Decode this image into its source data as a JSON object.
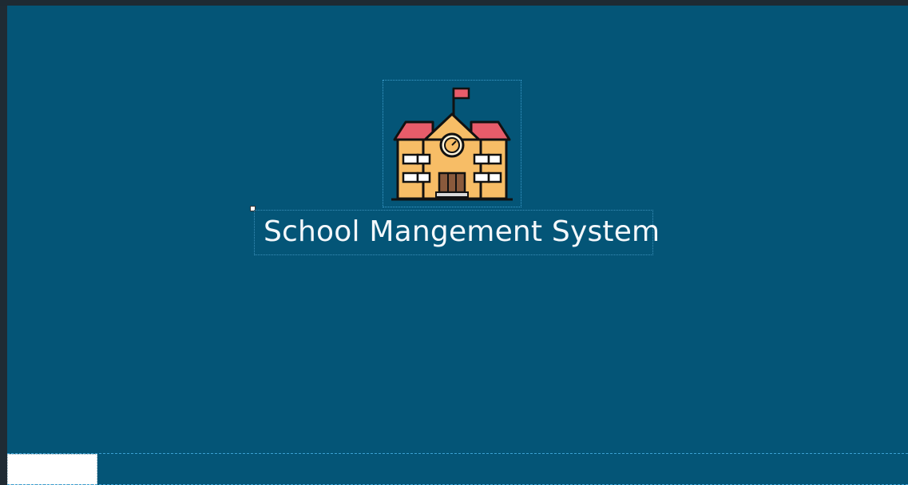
{
  "app": {
    "title": "School Mangement System"
  },
  "logo": {
    "icon": "school-building-icon"
  },
  "colors": {
    "form_background": "#045577",
    "title_text": "#f4f8fb",
    "roof": "#e85c6a",
    "building": "#f7bd66",
    "flag": "#e85c6a"
  }
}
